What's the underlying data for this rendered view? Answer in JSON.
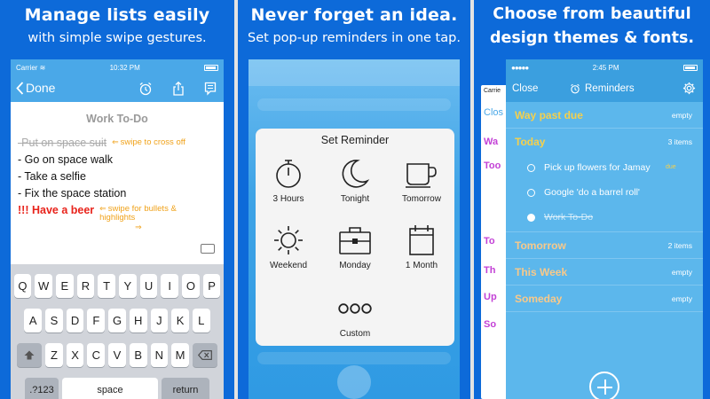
{
  "panel1": {
    "caption_line1": "Manage lists easily",
    "caption_line2": "with simple swipe gestures.",
    "status": {
      "carrier": "Carrier",
      "time": "10:32 PM"
    },
    "nav": {
      "back_label": "Done"
    },
    "note": {
      "title": "Work To-Do",
      "lines": [
        {
          "text": "Put on space suit",
          "struck": true
        },
        {
          "text": "- Go on space walk"
        },
        {
          "text": "- Take a selfie"
        },
        {
          "text": "- Fix the space station"
        },
        {
          "text": "!!! Have a beer"
        }
      ],
      "hint_swipe_cross": "swipe to cross off",
      "hint_swipe_bullets": "swipe for bullets & highlights"
    },
    "keyboard": {
      "row1": [
        "Q",
        "W",
        "E",
        "R",
        "T",
        "Y",
        "U",
        "I",
        "O",
        "P"
      ],
      "row2": [
        "A",
        "S",
        "D",
        "F",
        "G",
        "H",
        "J",
        "K",
        "L"
      ],
      "row3": [
        "Z",
        "X",
        "C",
        "V",
        "B",
        "N",
        "M"
      ],
      "numbers_key": ".?123",
      "space_key": "space",
      "return_key": "return"
    }
  },
  "panel2": {
    "caption_line1": "Never forget an idea.",
    "caption_line2": "Set pop-up reminders in one tap.",
    "reminder": {
      "title": "Set Reminder",
      "options": [
        "3 Hours",
        "Tonight",
        "Tomorrow",
        "Weekend",
        "Monday",
        "1 Month",
        "Custom"
      ]
    }
  },
  "panel3": {
    "caption_line1": "Choose from beautiful",
    "caption_line2": "design themes & fonts.",
    "ghost": {
      "carrier": "Carrie",
      "close": "Clos",
      "labels": [
        "Wa",
        "Too",
        "To",
        "Th",
        "Up",
        "So"
      ]
    },
    "status": {
      "time": "2:45 PM"
    },
    "nav": {
      "close_label": "Close",
      "title": "Reminders"
    },
    "lists": [
      {
        "name": "Way past due",
        "count": "empty",
        "color": "#f5d04c"
      },
      {
        "name": "Today",
        "count": "3 items",
        "color": "#f5d04c"
      },
      {
        "name": "Tomorrow",
        "count": "2 items",
        "color": "#f8c98a"
      },
      {
        "name": "This Week",
        "count": "empty",
        "color": "#f8c98a"
      },
      {
        "name": "Someday",
        "count": "empty",
        "color": "#f8c98a"
      }
    ],
    "today_items": [
      {
        "text": "Pick up flowers for Jamay",
        "due": "due"
      },
      {
        "text": "Google 'do a barrel roll'"
      },
      {
        "text": "Work To-Do",
        "done": true
      }
    ]
  },
  "colors": {
    "background": "#0d6ad9",
    "accent": "#4aa8e8",
    "highlight_red": "#e8231b",
    "hint_orange": "#f0a21a"
  }
}
